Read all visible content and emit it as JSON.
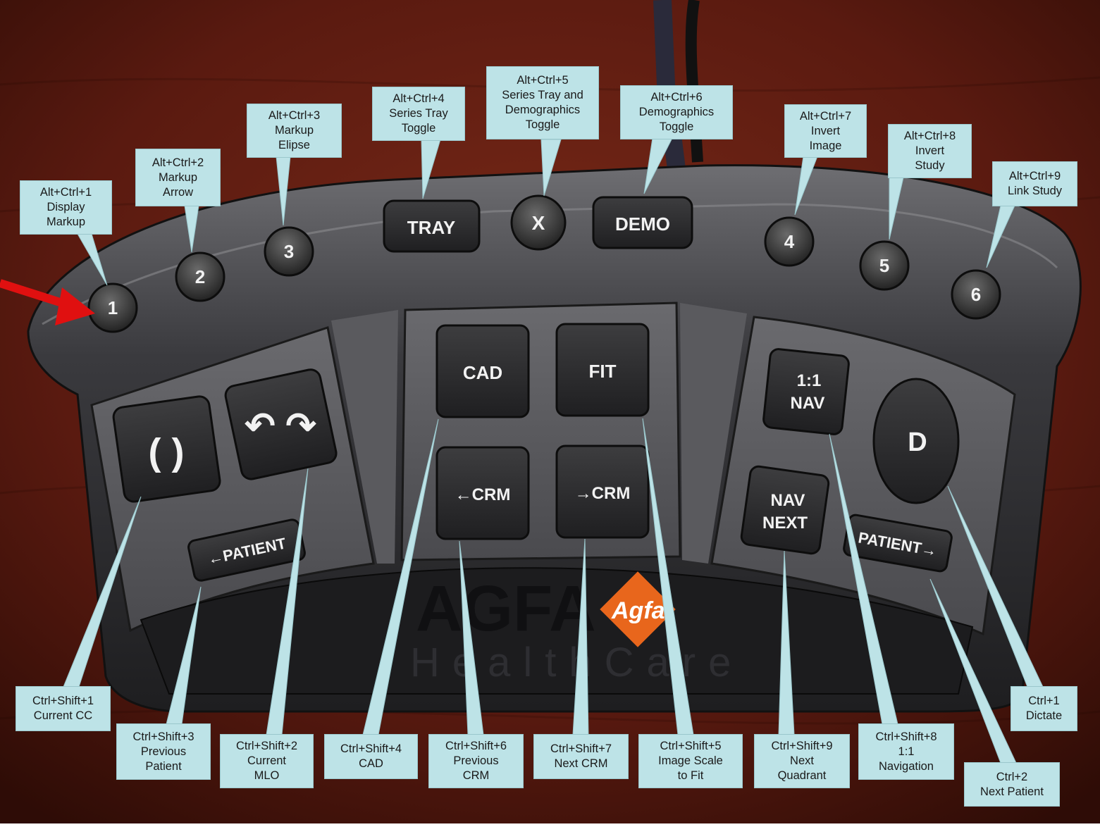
{
  "device": {
    "brand": "AGFA",
    "brand_badge": "Agfa",
    "brand_sub": "HealthCare"
  },
  "keys": {
    "k1": "1",
    "k2": "2",
    "k3": "3",
    "k4": "4",
    "k5": "5",
    "k6": "6",
    "tray": "TRAY",
    "x": "X",
    "demo": "DEMO",
    "paren": "( )",
    "rotate": "↶ ↷",
    "prev_patient": "←PATIENT",
    "cad": "CAD",
    "fit": "FIT",
    "prev_crm": "←CRM",
    "next_crm": "→CRM",
    "nav_11_line1": "1:1",
    "nav_11_line2": "NAV",
    "nav_next_line1": "NAV",
    "nav_next_line2": "NEXT",
    "next_patient": "PATIENT→",
    "dictate": "D"
  },
  "callouts": {
    "display_markup": [
      "Alt+Ctrl+1",
      "Display",
      "Markup"
    ],
    "markup_arrow": [
      "Alt+Ctrl+2",
      "Markup",
      "Arrow"
    ],
    "markup_elipse": [
      "Alt+Ctrl+3",
      "Markup",
      "Elipse"
    ],
    "series_tray_toggle": [
      "Alt+Ctrl+4",
      "Series Tray",
      "Toggle"
    ],
    "series_tray_demo_toggle": [
      "Alt+Ctrl+5",
      "Series Tray and",
      "Demographics",
      "Toggle"
    ],
    "demographics_toggle": [
      "Alt+Ctrl+6",
      "Demographics",
      "Toggle"
    ],
    "invert_image": [
      "Alt+Ctrl+7",
      "Invert",
      "Image"
    ],
    "invert_study": [
      "Alt+Ctrl+8",
      "Invert",
      "Study"
    ],
    "link_study": [
      "Alt+Ctrl+9",
      "Link Study"
    ],
    "current_cc": [
      "Ctrl+Shift+1",
      "Current CC"
    ],
    "previous_patient": [
      "Ctrl+Shift+3",
      "Previous",
      "Patient"
    ],
    "current_mlo": [
      "Ctrl+Shift+2",
      "Current",
      "MLO"
    ],
    "cad": [
      "Ctrl+Shift+4",
      "CAD"
    ],
    "previous_crm": [
      "Ctrl+Shift+6",
      "Previous",
      "CRM"
    ],
    "next_crm": [
      "Ctrl+Shift+7",
      "Next CRM"
    ],
    "image_scale_fit": [
      "Ctrl+Shift+5",
      "Image Scale",
      "to Fit"
    ],
    "next_quadrant": [
      "Ctrl+Shift+9",
      "Next",
      "Quadrant"
    ],
    "navigation_11": [
      "Ctrl+Shift+8",
      "1:1",
      "Navigation"
    ],
    "next_patient": [
      "Ctrl+2",
      "Next Patient"
    ],
    "dictate": [
      "Ctrl+1",
      "Dictate"
    ]
  },
  "colors": {
    "wood": "#5a1a10",
    "callout": "#bde3e7",
    "arrow": "#e01010",
    "body": "#2b2b2e"
  }
}
